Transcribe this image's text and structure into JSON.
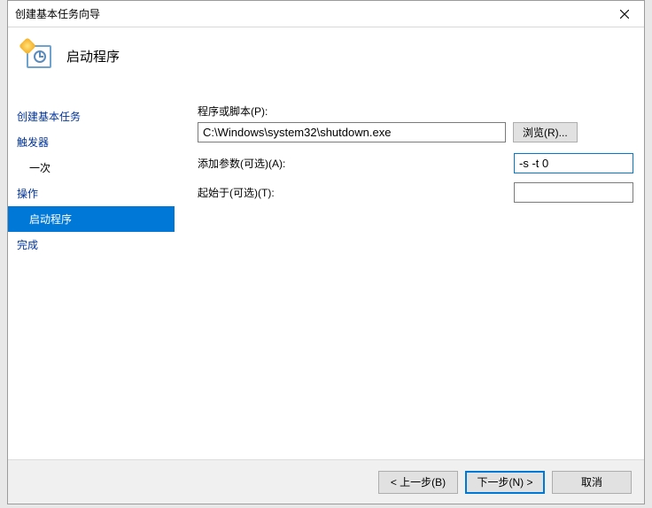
{
  "window": {
    "title": "创建基本任务向导"
  },
  "header": {
    "title": "启动程序"
  },
  "sidebar": {
    "items": [
      {
        "label": "创建基本任务",
        "type": "link"
      },
      {
        "label": "触发器",
        "type": "link"
      },
      {
        "label": "一次",
        "type": "indent"
      },
      {
        "label": "操作",
        "type": "link"
      },
      {
        "label": "启动程序",
        "type": "selected"
      },
      {
        "label": "完成",
        "type": "link"
      }
    ]
  },
  "form": {
    "program_label": "程序或脚本(P):",
    "program_value": "C:\\Windows\\system32\\shutdown.exe",
    "browse_label": "浏览(R)...",
    "args_label": "添加参数(可选)(A):",
    "args_value": "-s -t 0",
    "startin_label": "起始于(可选)(T):",
    "startin_value": ""
  },
  "footer": {
    "back": "< 上一步(B)",
    "next": "下一步(N) >",
    "cancel": "取消"
  }
}
